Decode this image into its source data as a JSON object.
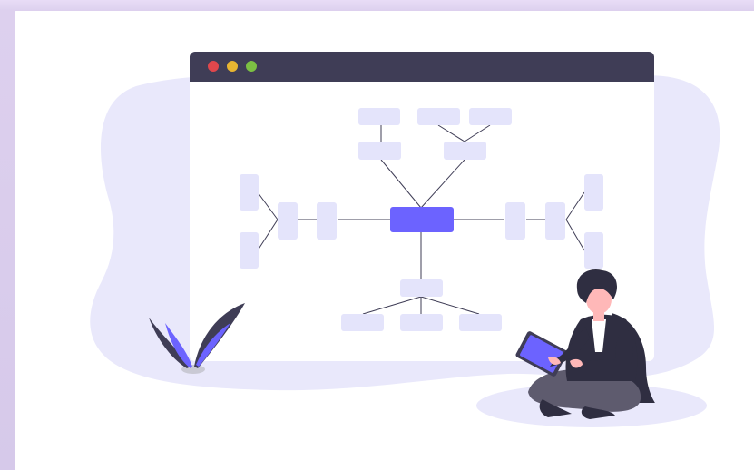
{
  "illustration": {
    "subject": "mind-map",
    "colors": {
      "page_background": "#e2d5f1",
      "panel": "#ffffff",
      "blob": "#e9e8fb",
      "window_bar": "#3f3d56",
      "window_body": "#ffffff",
      "node": "#e4e4fb",
      "central_node": "#6c63ff",
      "connector": "#3f3d56",
      "dot_red": "#e0474c",
      "dot_yellow": "#e8b531",
      "dot_green": "#7cc043",
      "skin": "#ffb8b8",
      "hair": "#2f2e41",
      "jacket": "#2f2e41",
      "pants": "#5e5b6e",
      "tablet": "#6c63ff",
      "plant_dark": "#3f3d56",
      "plant_accent": "#6c63ff",
      "pot": "#c9c9d4"
    },
    "icons": [
      "window-close-dot",
      "window-minimize-dot",
      "window-maximize-dot",
      "tablet-icon",
      "plant-icon"
    ]
  }
}
